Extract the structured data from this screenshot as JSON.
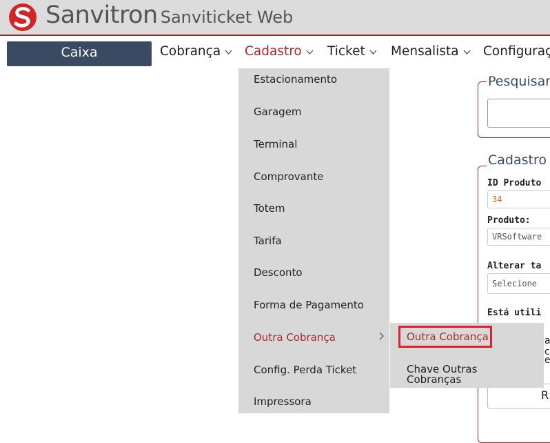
{
  "header": {
    "brand_main": "Sanvitron",
    "brand_sub": "Sanviticket Web"
  },
  "nav": {
    "caixa": "Caixa",
    "items": [
      "Cobrança",
      "Cadastro",
      "Ticket",
      "Mensalista",
      "Configuraçã"
    ],
    "active": "Cadastro"
  },
  "dropdown": {
    "items": [
      "Estacionamento",
      "Garagem",
      "Terminal",
      "Comprovante",
      "Totem",
      "Tarifa",
      "Desconto",
      "Forma de Pagamento",
      "Outra Cobrança",
      "Config. Perda Ticket",
      "Impressora"
    ],
    "highlighted": "Outra Cobrança"
  },
  "submenu": {
    "items": [
      "Outra Cobrança",
      "Chave Outras Cobranças"
    ]
  },
  "background": {
    "pesquisar_legend": "Pesquisar",
    "cadastro_legend": "Cadastro F",
    "id_label": "ID Produto",
    "id_value": "34",
    "produto_label": "Produto:",
    "produto_value": "VRSoftware",
    "alterar_label": "Alterar ta",
    "selecione_value": "Selecione",
    "esta_label": "Está utili",
    "partial_1": "a c",
    "partial_2": "e",
    "partial_3": "R"
  },
  "colors": {
    "accent": "#a52a2a",
    "nav_dark": "#3b4a63",
    "highlight_border": "#e0202a",
    "menu_bg": "#d8d8d8"
  }
}
